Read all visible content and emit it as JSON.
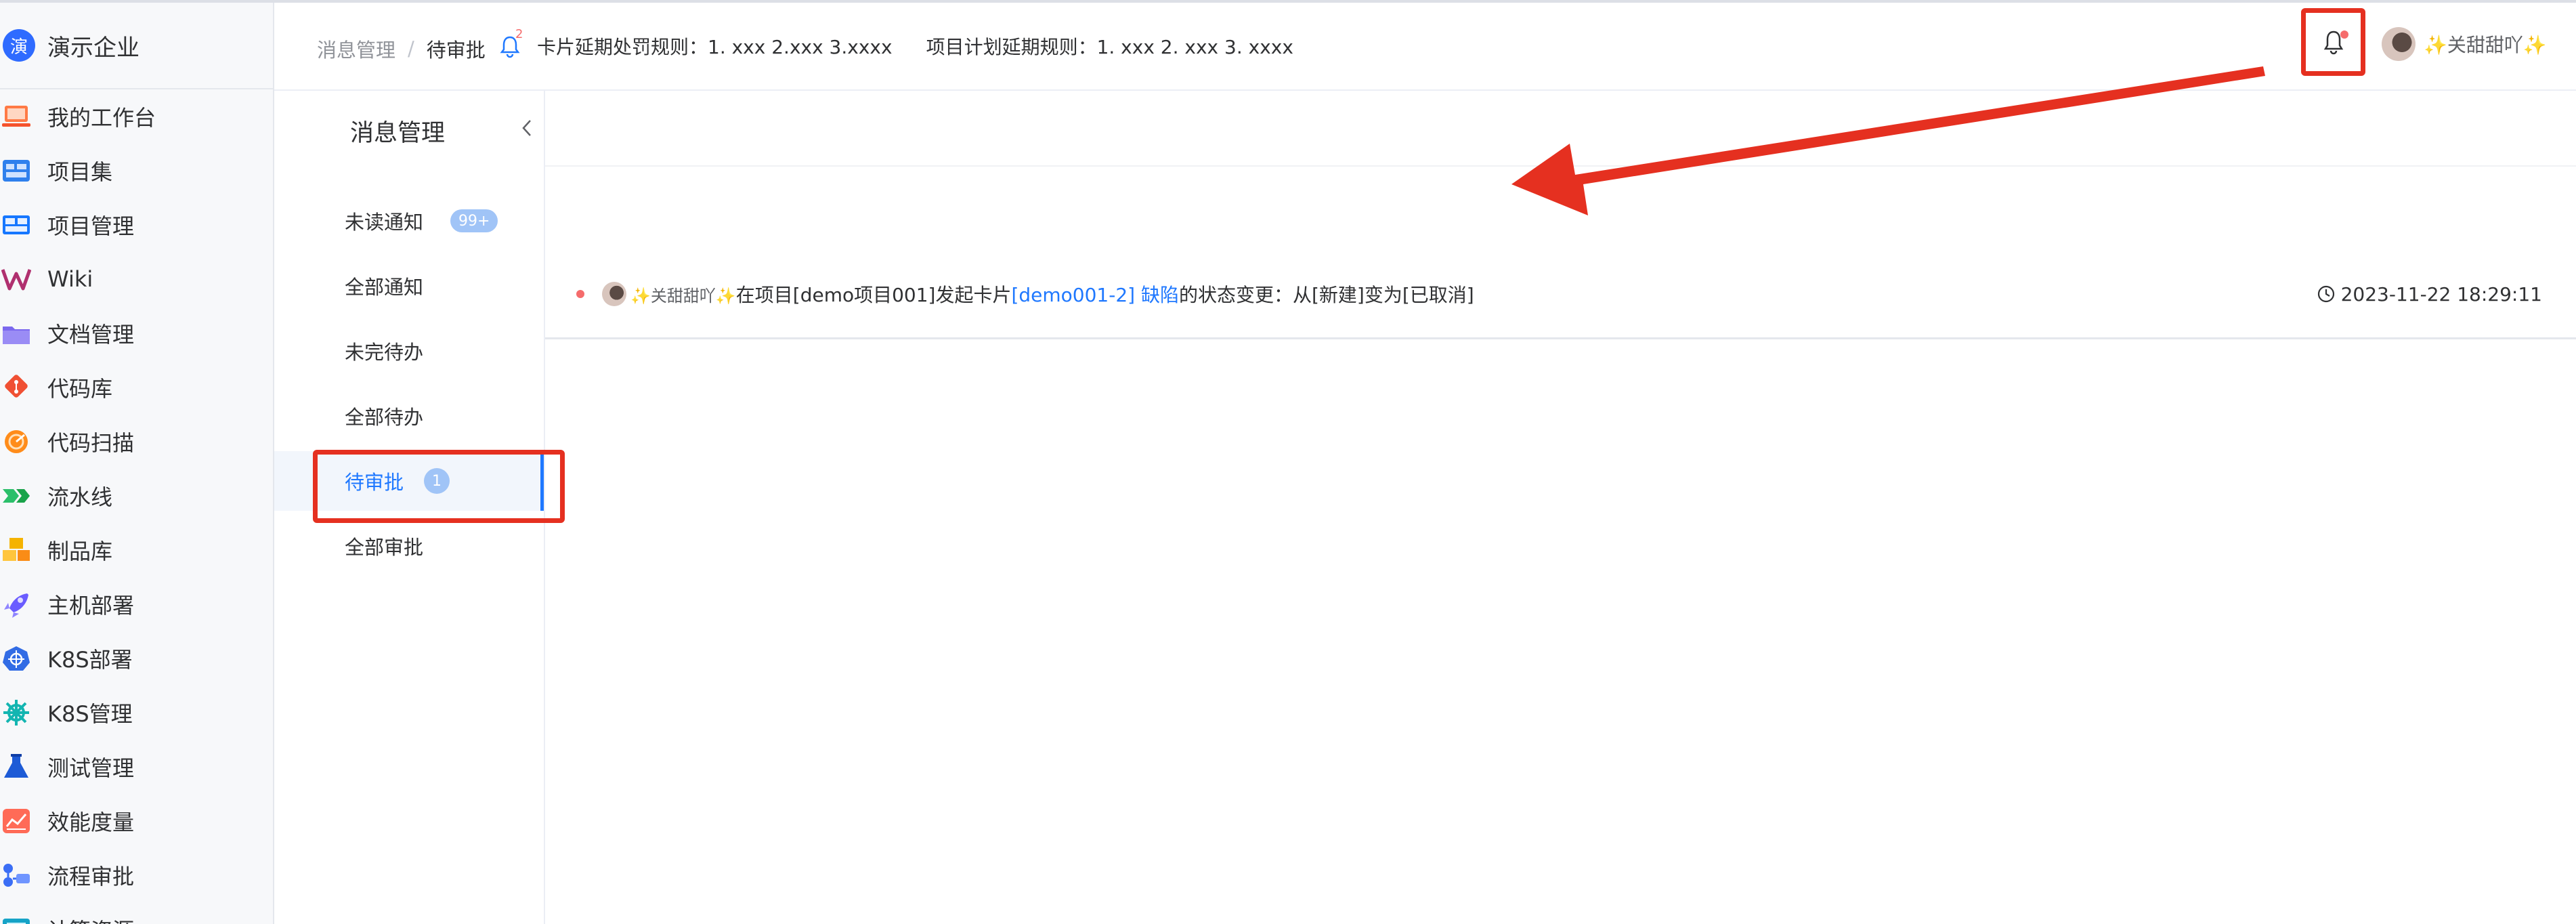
{
  "app": {
    "brand_logo_char": "演",
    "brand_name": "演示企业",
    "nav": [
      {
        "label": "我的工作台",
        "icon": "laptop-icon"
      },
      {
        "label": "项目集",
        "icon": "project-set-icon"
      },
      {
        "label": "项目管理",
        "icon": "project-manage-icon"
      },
      {
        "label": "Wiki",
        "icon": "wiki-icon"
      },
      {
        "label": "文档管理",
        "icon": "folder-icon"
      },
      {
        "label": "代码库",
        "icon": "git-icon"
      },
      {
        "label": "代码扫描",
        "icon": "scan-icon"
      },
      {
        "label": "流水线",
        "icon": "pipeline-icon"
      },
      {
        "label": "制品库",
        "icon": "artifact-icon"
      },
      {
        "label": "主机部署",
        "icon": "rocket-icon"
      },
      {
        "label": "K8S部署",
        "icon": "k8s-deploy-icon"
      },
      {
        "label": "K8S管理",
        "icon": "helm-icon"
      },
      {
        "label": "测试管理",
        "icon": "flask-icon"
      },
      {
        "label": "效能度量",
        "icon": "chart-icon"
      },
      {
        "label": "流程审批",
        "icon": "flow-icon"
      },
      {
        "label": "计算资源",
        "icon": "resource-icon"
      }
    ]
  },
  "header": {
    "breadcrumb_parent": "消息管理",
    "breadcrumb_sep": "/",
    "breadcrumb_current": "待审批",
    "announce_count": "2",
    "announce_1": "卡片延期处罚规则：1. xxx 2.xxx 3.xxxx",
    "announce_2": "项目计划延期规则：1. xxx 2. xxx 3. xxxx",
    "user_name": "✨关甜甜吖✨"
  },
  "submenu": {
    "title": "消息管理",
    "items": [
      {
        "label": "未读通知",
        "badge": "99+"
      },
      {
        "label": "全部通知",
        "badge": ""
      },
      {
        "label": "未完待办",
        "badge": ""
      },
      {
        "label": "全部待办",
        "badge": ""
      },
      {
        "label": "待审批",
        "badge": "1"
      },
      {
        "label": "全部审批",
        "badge": ""
      }
    ],
    "active_index": 4
  },
  "message": {
    "user": "✨关甜甜吖✨",
    "text_1": "在项目[demo项目001]发起卡片",
    "card_link": "[demo001-2] 缺陷",
    "text_2": "的状态变更：从[新建]变为[已取消]",
    "time": "2023-11-22 18:29:11"
  },
  "colors": {
    "accent": "#1f78ff",
    "annotation_red": "#e53020",
    "badge": "#a0c4f7",
    "unread": "#f56c6c"
  }
}
